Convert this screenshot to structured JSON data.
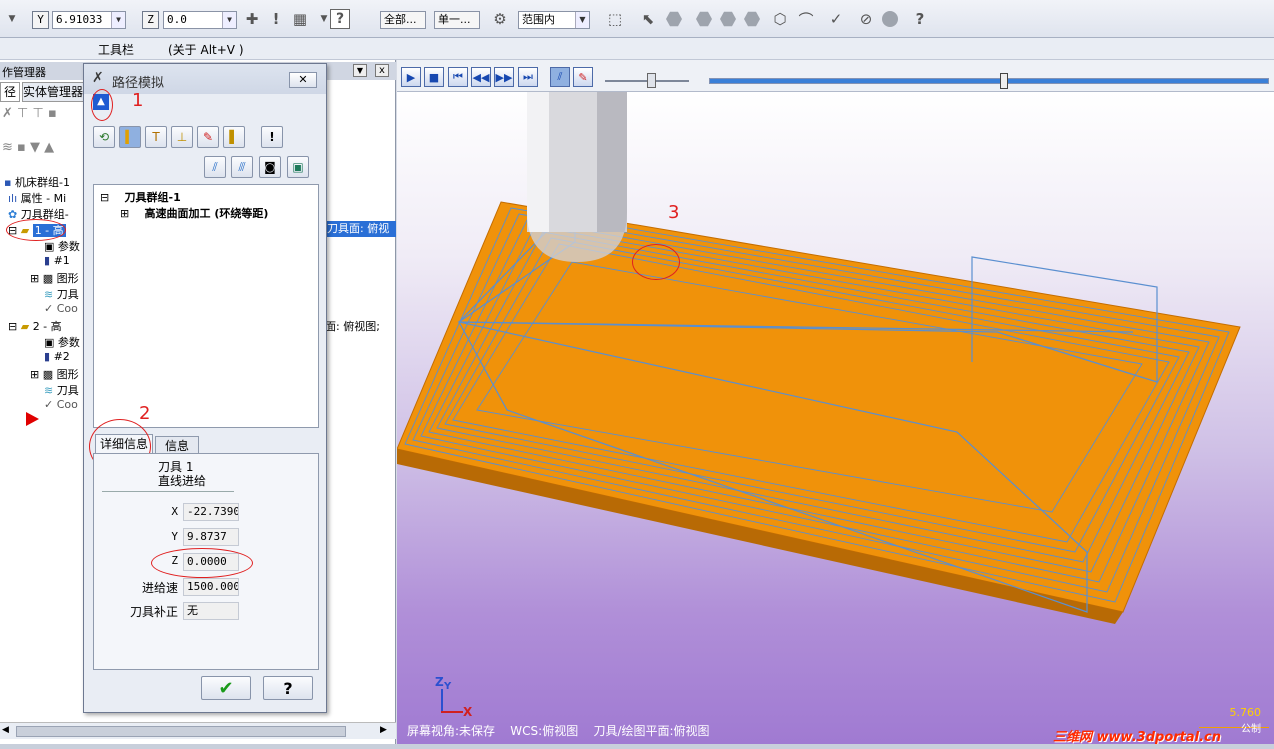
{
  "toolbar": {
    "y_label": "Y",
    "y_value": "6.91033",
    "z_label": "Z",
    "z_value": "0.0",
    "all_label": "全部...",
    "single_label": "单一...",
    "range_label": "范围内"
  },
  "menubar": {
    "toolbar_item": "工具栏",
    "about_item": "(关于 Alt+V )"
  },
  "left_panel": {
    "title": "作管理器",
    "tab_path": "径",
    "tab_solid": "实体管理器",
    "tree": [
      "机床群组-1",
      "属性 - Mi",
      "刀具群组-",
      "1 - 高",
      "参数",
      "#1",
      "图形",
      "刀具",
      "Coo",
      "2 - 高",
      "参数",
      "#2",
      "图形",
      "刀具",
      "Coo"
    ],
    "overflow_1": "刀具面: 俯视",
    "overflow_2": "面: 俯视图;"
  },
  "dialog": {
    "title": "路径模拟",
    "tree_root": "刀具群组-1",
    "tree_child": "高速曲面加工 (环绕等距)",
    "tab_detail": "详细信息",
    "tab_info": "信息",
    "tool_line": "刀具 1",
    "move_line": "直线进给",
    "x_label": "X",
    "x_value": "-22.7390",
    "y_label": "Y",
    "y_value": "9.8737",
    "z_label": "Z",
    "z_value": "0.0000",
    "feed_label": "进给速",
    "feed_value": "1500.0000",
    "comp_label": "刀具补正",
    "comp_value": "无"
  },
  "viewport": {
    "status_text": "屏幕视角:未保存    WCS:俯视图    刀具/绘图平面:俯视图",
    "axis_z": "Z",
    "axis_y": "Y",
    "axis_x": "X",
    "scale_value": "5.760",
    "scale_unit": "公制",
    "watermark": "三维网 www.3dportal.cn"
  },
  "annotations": [
    "1",
    "2",
    "3"
  ],
  "colors": {
    "stock": "#f0920a",
    "toolpath": "#5a8fd0",
    "annotation": "#e02020"
  }
}
